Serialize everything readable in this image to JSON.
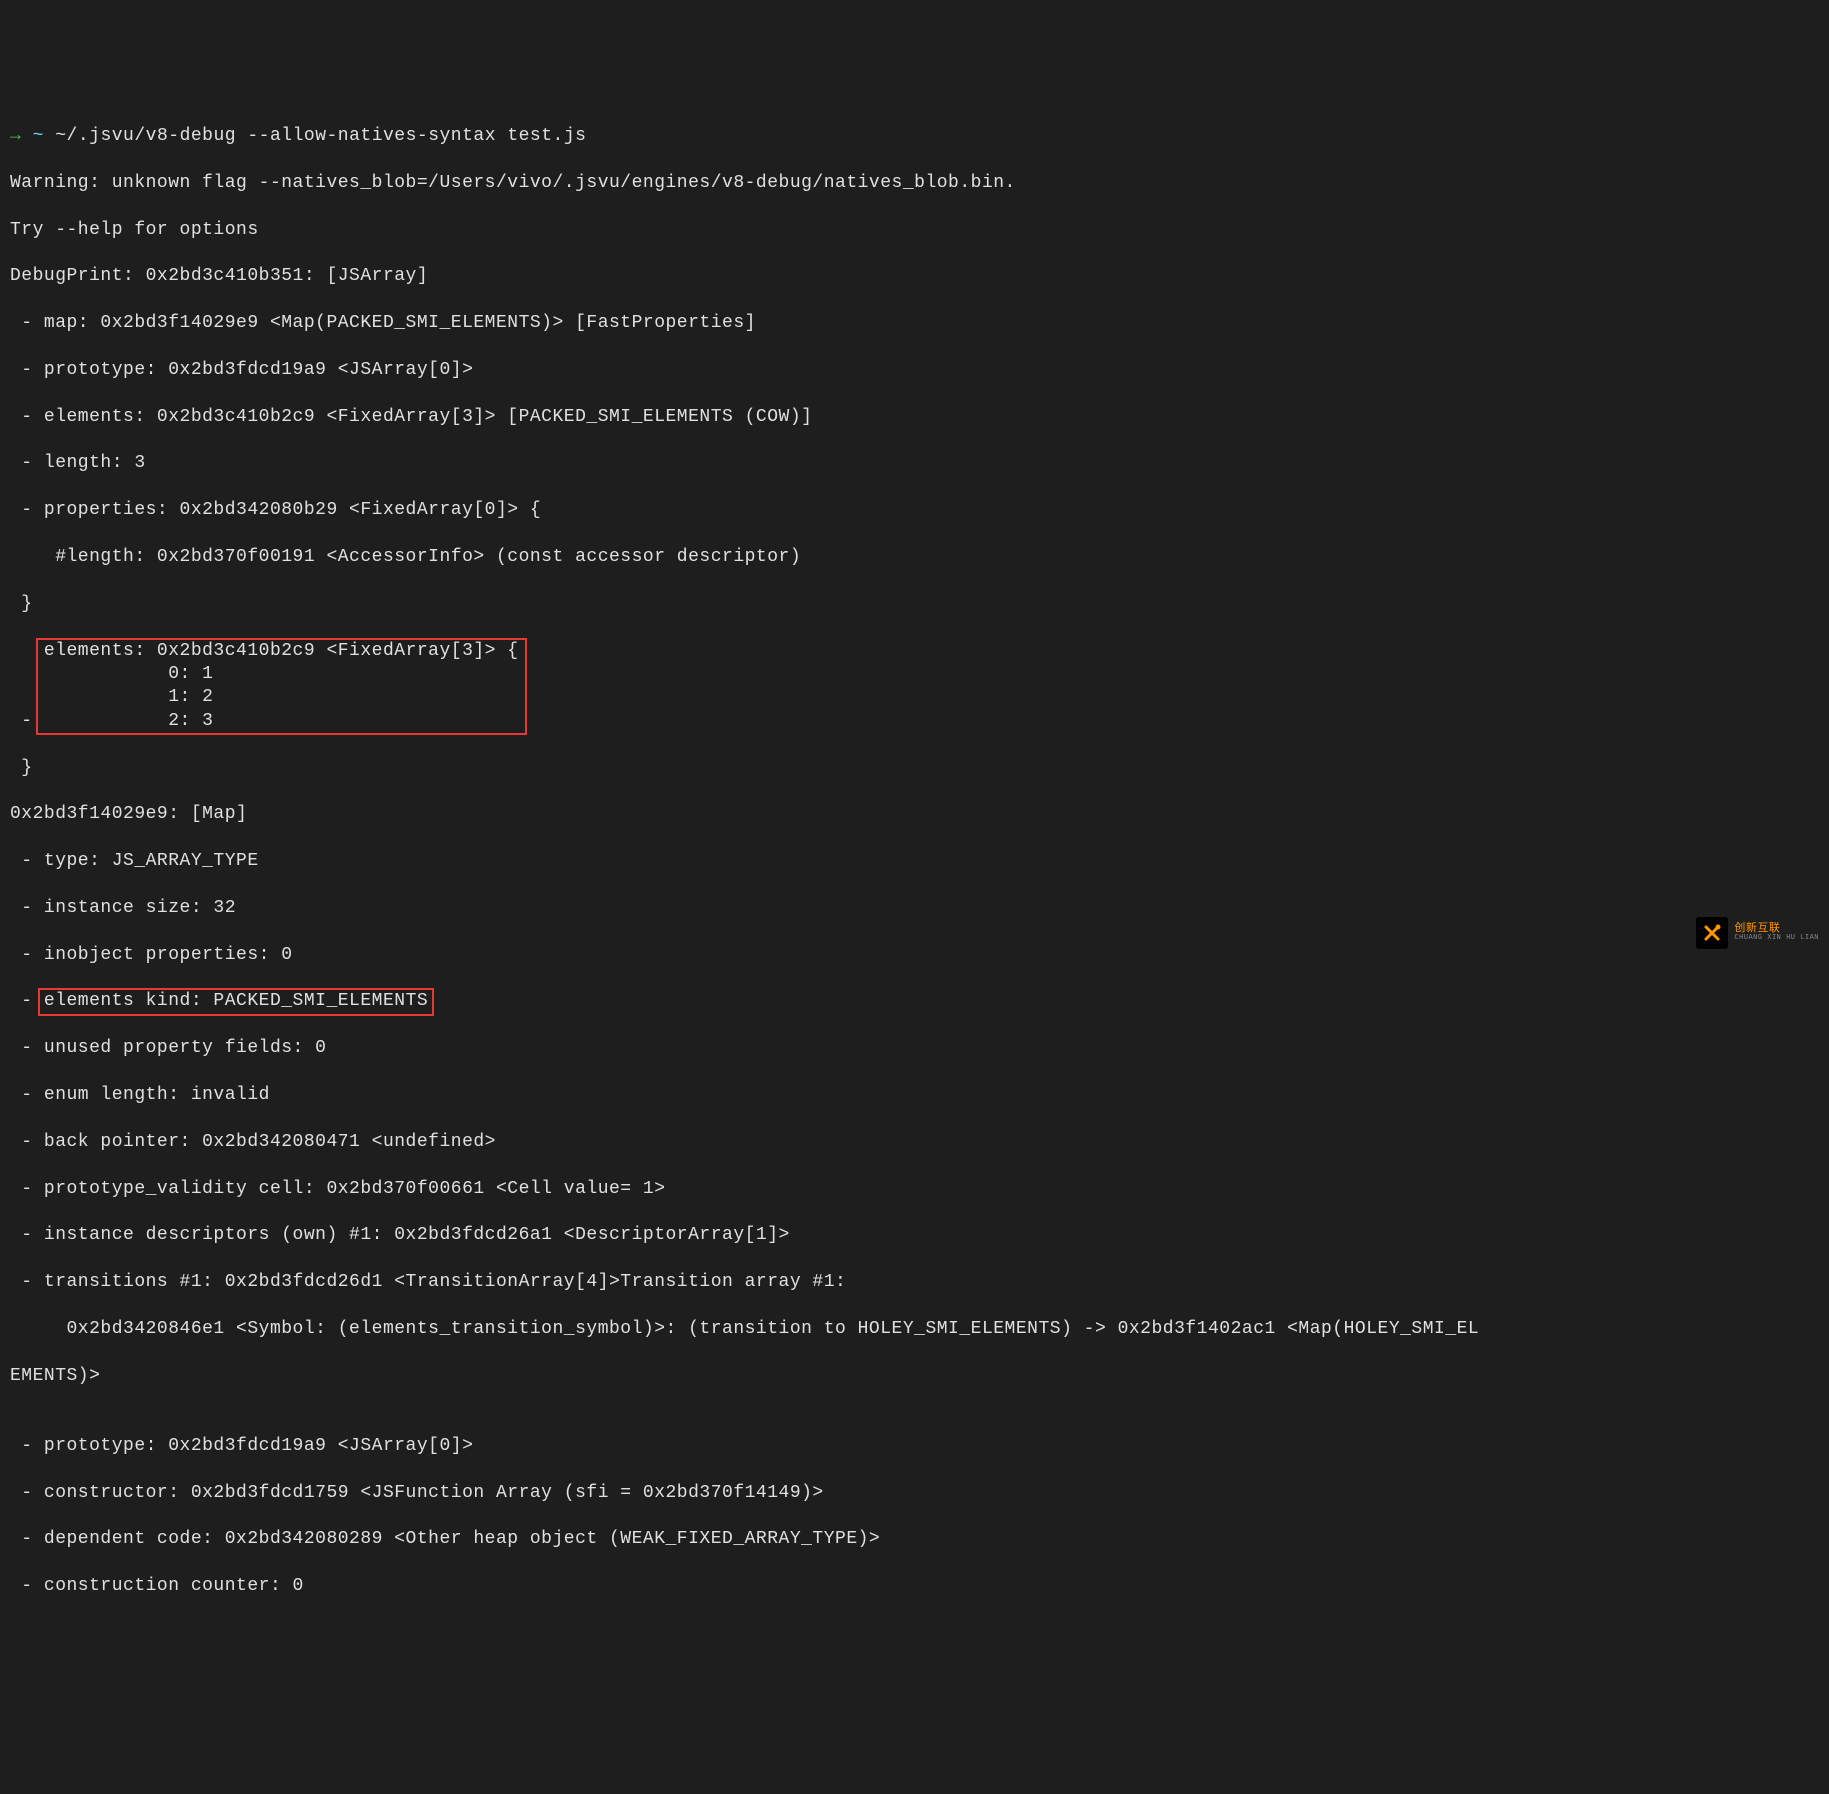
{
  "prompt": {
    "arrow": "→",
    "tilde": "~",
    "command": "~/.jsvu/v8-debug --allow-natives-syntax test.js"
  },
  "lines": {
    "warning": "Warning: unknown flag --natives_blob=/Users/vivo/.jsvu/engines/v8-debug/natives_blob.bin.",
    "tryhelp": "Try --help for options",
    "debugprint": "DebugPrint: 0x2bd3c410b351: [JSArray]",
    "map": " - map: 0x2bd3f14029e9 <Map(PACKED_SMI_ELEMENTS)> [FastProperties]",
    "prototype": " - prototype: 0x2bd3fdcd19a9 <JSArray[0]>",
    "elements": " - elements: 0x2bd3c410b2c9 <FixedArray[3]> [PACKED_SMI_ELEMENTS (COW)]",
    "length": " - length: 3",
    "properties": " - properties: 0x2bd342080b29 <FixedArray[0]> {",
    "hashlength": "    #length: 0x2bd370f00191 <AccessorInfo> (const accessor descriptor)",
    "closebrace1": " }",
    "dash_prefix": " - ",
    "elements2_open": "elements: 0x2bd3c410b2c9 <FixedArray[3]> {",
    "el0": "           0: 1",
    "el1": "           1: 2",
    "el2": "           2: 3",
    "closebrace2": " }",
    "mapheader": "0x2bd3f14029e9: [Map]",
    "type": " - type: JS_ARRAY_TYPE",
    "instancesize": " - instance size: 32",
    "inobject": " - inobject properties: 0",
    "dash_prefix2": " - ",
    "elementskind": "elements kind: PACKED_SMI_ELEMENTS",
    "unused": " - unused property fields: 0",
    "enum": " - enum length: invalid",
    "backpointer": " - back pointer: 0x2bd342080471 <undefined>",
    "protovalidity": " - prototype_validity cell: 0x2bd370f00661 <Cell value= 1>",
    "instancedesc": " - instance descriptors (own) #1: 0x2bd3fdcd26a1 <DescriptorArray[1]>",
    "transitions": " - transitions #1: 0x2bd3fdcd26d1 <TransitionArray[4]>Transition array #1:",
    "transitionsym": "     0x2bd3420846e1 <Symbol: (elements_transition_symbol)>: (transition to HOLEY_SMI_ELEMENTS) -> 0x2bd3f1402ac1 <Map(HOLEY_SMI_EL",
    "ements": "EMENTS)>",
    "blank": "",
    "prototype2": " - prototype: 0x2bd3fdcd19a9 <JSArray[0]>",
    "constructor": " - constructor: 0x2bd3fdcd1759 <JSFunction Array (sfi = 0x2bd370f14149)>",
    "dependent": " - dependent code: 0x2bd342080289 <Other heap object (WEAK_FIXED_ARRAY_TYPE)>",
    "construction": " - construction counter: 0"
  },
  "watermark": {
    "icon": "✕",
    "text": "创新互联",
    "sub": "CHUANG XIN HU LIAN"
  }
}
